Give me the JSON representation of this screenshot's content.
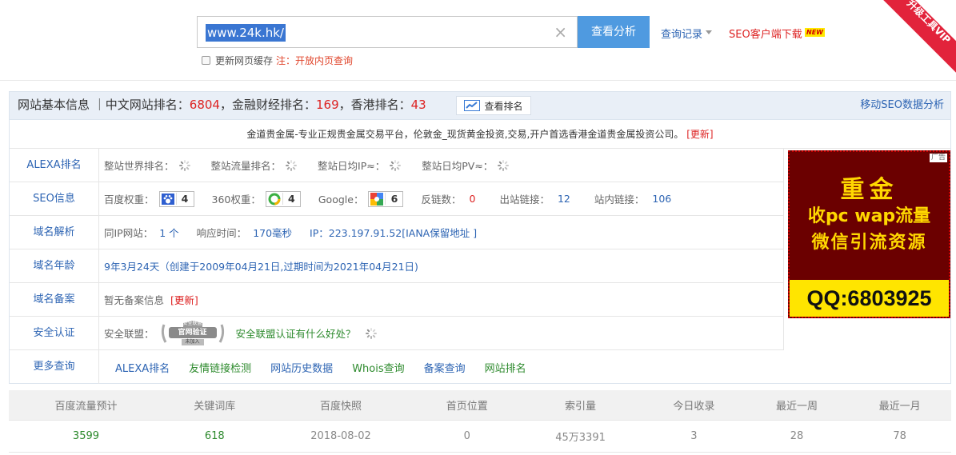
{
  "search": {
    "query": "www.24k.hk/",
    "button": "查看分析",
    "history": "查询记录",
    "seo_download": "SEO客户端下载",
    "new_badge": "NEW",
    "cache_label": "更新网页缓存",
    "cache_note": "注：开放内页查询",
    "ribbon": "升级工具VIP"
  },
  "panel": {
    "title_prefix": "网站基本信息 ｜中文网站排名：",
    "cn_rank": "6804",
    "finance_prefix": "，金融财经排名：",
    "finance_rank": "169",
    "hk_prefix": "，香港排名：",
    "hk_rank": "43",
    "rank_button": "查看排名",
    "mobile_seo": "移动SEO数据分析",
    "description": "金道贵金属-专业正规贵金属交易平台，伦敦金_现货黄金投资,交易,开户首选香港金道贵金属投资公司。",
    "update": "[更新]"
  },
  "rows": {
    "alexa": {
      "label": "ALEXA排名",
      "world": "整站世界排名：",
      "traffic": "整站流量排名：",
      "ip": "整站日均IP≈：",
      "pv": "整站日均PV≈："
    },
    "seo": {
      "label": "SEO信息",
      "baidu": "百度权重：",
      "baidu_val": "4",
      "s360": "360权重：",
      "s360_val": "4",
      "google": "Google：",
      "google_val": "6",
      "backlinks": "反链数：",
      "backlinks_val": "0",
      "outlinks": "出站链接：",
      "outlinks_val": "12",
      "inlinks": "站内链接：",
      "inlinks_val": "106"
    },
    "dns": {
      "label": "域名解析",
      "same_ip": "同IP网站：",
      "same_ip_val": "1 个",
      "response": "响应时间：",
      "response_val": "170毫秒",
      "ip": "IP：223.197.91.52[IANA保留地址 ]"
    },
    "age": {
      "label": "域名年龄",
      "value": "9年3月24天（创建于2009年04月21日,过期时间为2021年04月21日)"
    },
    "icp": {
      "label": "域名备案",
      "value": "暂无备案信息",
      "update": "[更新]"
    },
    "security": {
      "label": "安全认证",
      "alliance": "安全联盟：",
      "seal_top": "安全联盟",
      "seal_mid": "官网验证",
      "seal_bot": "未加入",
      "question": "安全联盟认证有什么好处？"
    },
    "more": {
      "label": "更多查询",
      "links": [
        "ALEXA排名",
        "友情链接检测",
        "网站历史数据",
        "Whois查询",
        "备案查询",
        "网站排名"
      ]
    }
  },
  "ad": {
    "tag": "广告",
    "line1": "重金",
    "line2": "收pc wap流量",
    "line3": "微信引流资源",
    "qq": "QQ:6803925"
  },
  "stats": {
    "headers": [
      "百度流量预计",
      "关键词库",
      "百度快照",
      "首页位置",
      "索引量",
      "今日收录",
      "最近一周",
      "最近一月"
    ],
    "values": [
      "3599",
      "618",
      "2018-08-02",
      "0",
      "45万3391",
      "3",
      "28",
      "78"
    ]
  }
}
